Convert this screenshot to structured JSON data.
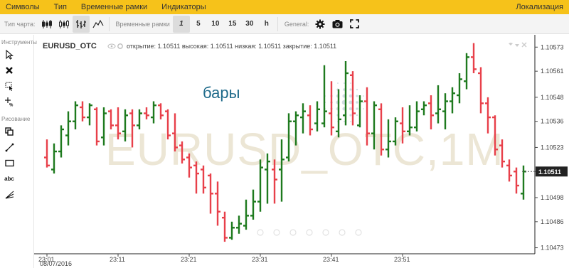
{
  "menu": {
    "items": [
      "Символы",
      "Тип",
      "Временные рамки",
      "Индикаторы"
    ],
    "right": "Локализация"
  },
  "toolbar": {
    "chart_type_label": "Тип чарта:",
    "chart_types": [
      "candles-icon",
      "hollow-candles-icon",
      "bars-icon",
      "line-icon"
    ],
    "active_chart_type": 2,
    "timeframes_label": "Временные рамки",
    "timeframes": [
      "1",
      "5",
      "10",
      "15",
      "30",
      "h"
    ],
    "active_timeframe": "1",
    "general_label": "General:"
  },
  "sidebar": {
    "tools_label": "Инструменты",
    "draw_label": "Рисование",
    "text_tool": "abc"
  },
  "chart": {
    "symbol": "EURUSD_OTC",
    "ohlc": "открытие: 1.10511 высокая: 1.10511 низкая: 1.10511 закрытие: 1.10511",
    "watermark": "EURUSD_OTC,1M",
    "type_label": "бары",
    "current_price": "1.10511",
    "colors": {
      "up": "#1e7a1e",
      "down": "#e8404a"
    }
  },
  "chart_data": {
    "type": "bar",
    "x_ticks": [
      "23:01",
      "23:11",
      "23:21",
      "23:31",
      "23:41",
      "23:51"
    ],
    "date_label": "08/07/2016",
    "y_ticks": [
      "1.10573",
      "1.10561",
      "1.10548",
      "1.10536",
      "1.10523",
      "1.10511",
      "1.10498",
      "1.10486",
      "1.10473"
    ],
    "ylim": [
      1.1047,
      1.10577
    ],
    "last_price": 1.10511,
    "bars": [
      {
        "o": 1.10518,
        "h": 1.10527,
        "l": 1.10513,
        "c": 1.10514
      },
      {
        "o": 1.10512,
        "h": 1.10525,
        "l": 1.1051,
        "c": 1.10521
      },
      {
        "o": 1.10521,
        "h": 1.10534,
        "l": 1.10518,
        "c": 1.10532
      },
      {
        "o": 1.10529,
        "h": 1.10541,
        "l": 1.10524,
        "c": 1.10536
      },
      {
        "o": 1.10536,
        "h": 1.10546,
        "l": 1.10532,
        "c": 1.10544
      },
      {
        "o": 1.10543,
        "h": 1.10546,
        "l": 1.10536,
        "c": 1.10538
      },
      {
        "o": 1.10538,
        "h": 1.10545,
        "l": 1.10534,
        "c": 1.10544
      },
      {
        "o": 1.10542,
        "h": 1.10543,
        "l": 1.10524,
        "c": 1.10526
      },
      {
        "o": 1.10528,
        "h": 1.10543,
        "l": 1.10524,
        "c": 1.1054
      },
      {
        "o": 1.10541,
        "h": 1.10542,
        "l": 1.10532,
        "c": 1.10534
      },
      {
        "o": 1.10534,
        "h": 1.10543,
        "l": 1.10527,
        "c": 1.1053
      },
      {
        "o": 1.10531,
        "h": 1.10542,
        "l": 1.10526,
        "c": 1.10539
      },
      {
        "o": 1.1054,
        "h": 1.10542,
        "l": 1.10523,
        "c": 1.10534
      },
      {
        "o": 1.10534,
        "h": 1.10542,
        "l": 1.10532,
        "c": 1.1054
      },
      {
        "o": 1.1054,
        "h": 1.10543,
        "l": 1.10537,
        "c": 1.10539
      },
      {
        "o": 1.10538,
        "h": 1.10546,
        "l": 1.10535,
        "c": 1.10544
      },
      {
        "o": 1.10544,
        "h": 1.10545,
        "l": 1.10537,
        "c": 1.10539
      },
      {
        "o": 1.10541,
        "h": 1.10542,
        "l": 1.10527,
        "c": 1.10529
      },
      {
        "o": 1.1053,
        "h": 1.1054,
        "l": 1.10521,
        "c": 1.10523
      },
      {
        "o": 1.10524,
        "h": 1.10526,
        "l": 1.10515,
        "c": 1.10517
      },
      {
        "o": 1.10518,
        "h": 1.1052,
        "l": 1.10508,
        "c": 1.10513
      },
      {
        "o": 1.10514,
        "h": 1.10516,
        "l": 1.105,
        "c": 1.1051
      },
      {
        "o": 1.10512,
        "h": 1.10514,
        "l": 1.105,
        "c": 1.10503
      },
      {
        "o": 1.10509,
        "h": 1.1051,
        "l": 1.1049,
        "c": 1.105
      },
      {
        "o": 1.105,
        "h": 1.10506,
        "l": 1.10484,
        "c": 1.10491
      },
      {
        "o": 1.10488,
        "h": 1.10491,
        "l": 1.10476,
        "c": 1.10478
      },
      {
        "o": 1.10478,
        "h": 1.10486,
        "l": 1.10477,
        "c": 1.10483
      },
      {
        "o": 1.10483,
        "h": 1.10489,
        "l": 1.1048,
        "c": 1.10485
      },
      {
        "o": 1.10484,
        "h": 1.10497,
        "l": 1.10482,
        "c": 1.10489
      },
      {
        "o": 1.10489,
        "h": 1.10502,
        "l": 1.10487,
        "c": 1.10496
      },
      {
        "o": 1.10496,
        "h": 1.10517,
        "l": 1.10491,
        "c": 1.10513
      },
      {
        "o": 1.10512,
        "h": 1.1052,
        "l": 1.10495,
        "c": 1.10516
      },
      {
        "o": 1.10512,
        "h": 1.10517,
        "l": 1.10495,
        "c": 1.10507
      },
      {
        "o": 1.10512,
        "h": 1.10527,
        "l": 1.10496,
        "c": 1.10517
      },
      {
        "o": 1.10518,
        "h": 1.1054,
        "l": 1.10516,
        "c": 1.10536
      },
      {
        "o": 1.10536,
        "h": 1.10541,
        "l": 1.10524,
        "c": 1.10539
      },
      {
        "o": 1.10538,
        "h": 1.10545,
        "l": 1.1053,
        "c": 1.10541
      },
      {
        "o": 1.10539,
        "h": 1.10544,
        "l": 1.10529,
        "c": 1.10532
      },
      {
        "o": 1.10535,
        "h": 1.10546,
        "l": 1.10531,
        "c": 1.10542
      },
      {
        "o": 1.10535,
        "h": 1.10564,
        "l": 1.10533,
        "c": 1.10541
      },
      {
        "o": 1.1054,
        "h": 1.10556,
        "l": 1.10529,
        "c": 1.10533
      },
      {
        "o": 1.10531,
        "h": 1.10552,
        "l": 1.10528,
        "c": 1.10537
      },
      {
        "o": 1.10539,
        "h": 1.10566,
        "l": 1.10534,
        "c": 1.1056
      },
      {
        "o": 1.10559,
        "h": 1.10561,
        "l": 1.10534,
        "c": 1.1054
      },
      {
        "o": 1.10534,
        "h": 1.10549,
        "l": 1.10533,
        "c": 1.10546
      },
      {
        "o": 1.10546,
        "h": 1.10553,
        "l": 1.10524,
        "c": 1.1053
      },
      {
        "o": 1.1053,
        "h": 1.10546,
        "l": 1.10522,
        "c": 1.10544
      },
      {
        "o": 1.10542,
        "h": 1.10545,
        "l": 1.10519,
        "c": 1.10522
      },
      {
        "o": 1.10522,
        "h": 1.10537,
        "l": 1.10518,
        "c": 1.10526
      },
      {
        "o": 1.10526,
        "h": 1.10538,
        "l": 1.10524,
        "c": 1.10536
      },
      {
        "o": 1.10535,
        "h": 1.10543,
        "l": 1.10525,
        "c": 1.10531
      },
      {
        "o": 1.10531,
        "h": 1.10544,
        "l": 1.10529,
        "c": 1.10533
      },
      {
        "o": 1.10533,
        "h": 1.10546,
        "l": 1.10531,
        "c": 1.10541
      },
      {
        "o": 1.10542,
        "h": 1.10546,
        "l": 1.10539,
        "c": 1.10544
      },
      {
        "o": 1.10545,
        "h": 1.10549,
        "l": 1.10532,
        "c": 1.10539
      },
      {
        "o": 1.1054,
        "h": 1.10554,
        "l": 1.10535,
        "c": 1.10542
      },
      {
        "o": 1.10541,
        "h": 1.1055,
        "l": 1.10532,
        "c": 1.10546
      },
      {
        "o": 1.10546,
        "h": 1.10553,
        "l": 1.1054,
        "c": 1.1055
      },
      {
        "o": 1.10549,
        "h": 1.1056,
        "l": 1.10545,
        "c": 1.10557
      },
      {
        "o": 1.10556,
        "h": 1.1057,
        "l": 1.10552,
        "c": 1.10568
      },
      {
        "o": 1.10568,
        "h": 1.10575,
        "l": 1.1056,
        "c": 1.10562
      },
      {
        "o": 1.1056,
        "h": 1.10563,
        "l": 1.1054,
        "c": 1.10545
      },
      {
        "o": 1.10545,
        "h": 1.10548,
        "l": 1.1053,
        "c": 1.10538
      },
      {
        "o": 1.10538,
        "h": 1.10539,
        "l": 1.10519,
        "c": 1.10522
      },
      {
        "o": 1.10524,
        "h": 1.10527,
        "l": 1.10513,
        "c": 1.10516
      },
      {
        "o": 1.10514,
        "h": 1.10517,
        "l": 1.10506,
        "c": 1.10509
      },
      {
        "o": 1.10511,
        "h": 1.10513,
        "l": 1.105,
        "c": 1.10504
      },
      {
        "o": 1.105,
        "h": 1.10514,
        "l": 1.10497,
        "c": 1.10511
      }
    ]
  }
}
